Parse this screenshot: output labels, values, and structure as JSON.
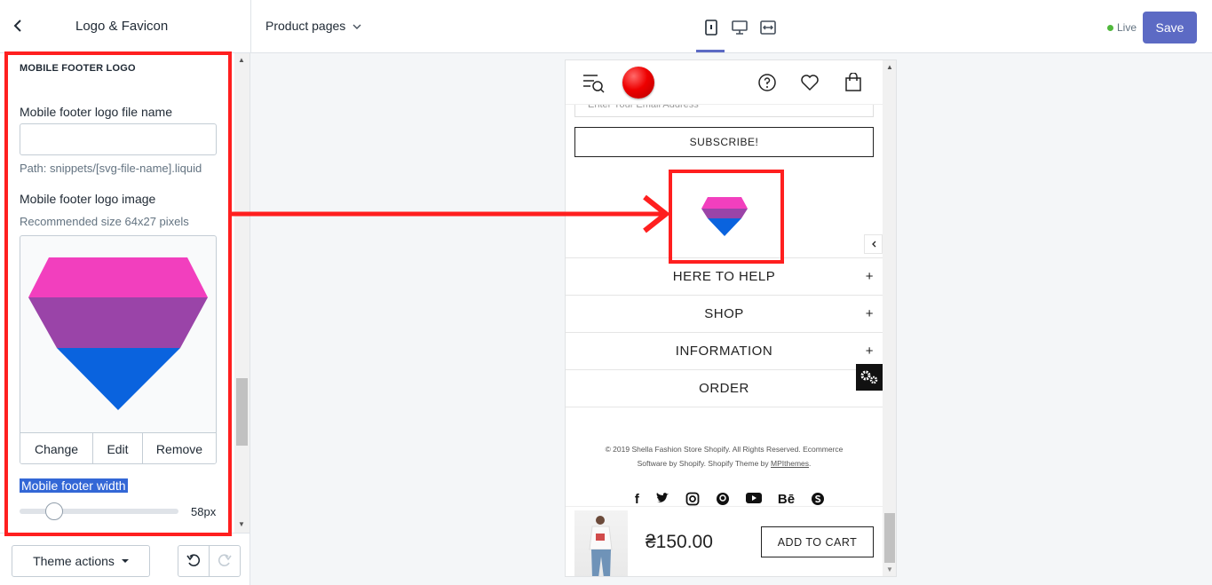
{
  "topbar": {
    "back_label": "<",
    "panel_title": "Logo & Favicon",
    "page_select": "Product pages",
    "live_label": "Live",
    "save_label": "Save"
  },
  "sidebar": {
    "section_heading": "MOBILE FOOTER LOGO",
    "file_name_label": "Mobile footer logo file name",
    "file_name_value": "",
    "path_help": "Path: snippets/[svg-file-name].liquid",
    "image_label": "Mobile footer logo image",
    "image_help": "Recommended size 64x27 pixels",
    "image_actions": {
      "change": "Change",
      "edit": "Edit",
      "remove": "Remove"
    },
    "width_label": "Mobile footer width",
    "width_value": "58px",
    "width_level": 58
  },
  "footer": {
    "theme_actions_label": "Theme actions",
    "undo_icon": "undo-icon",
    "redo_icon": "redo-icon"
  },
  "preview": {
    "email_placeholder": "Enter Your Email Address",
    "subscribe_label": "SUBSCRIBE!",
    "rows": [
      {
        "label": "HERE TO HELP",
        "plus": "+"
      },
      {
        "label": "SHOP",
        "plus": "+"
      },
      {
        "label": "INFORMATION",
        "plus": "+"
      },
      {
        "label": "ORDER",
        "plus": ""
      }
    ],
    "copyright_line1": "© 2019 Shella Fashion Store Shopify. All Rights Reserved. Ecommerce",
    "copyright_line2_pre": "Software by Shopify. Shopify Theme by ",
    "copyright_link": "MPIthemes",
    "copyright_line2_post": ".",
    "social": [
      "f",
      "t",
      "ig",
      "p",
      "yt",
      "Bē",
      "s"
    ],
    "price": "₴150.00",
    "add_to_cart": "ADD TO CART"
  },
  "colors": {
    "accent": "#5c6ac4",
    "live": "#50b83c",
    "annotation": "#ff1f1f",
    "logo_pink": "#f23fbe",
    "logo_purple": "#9a44a8",
    "logo_blue": "#0a63de"
  }
}
